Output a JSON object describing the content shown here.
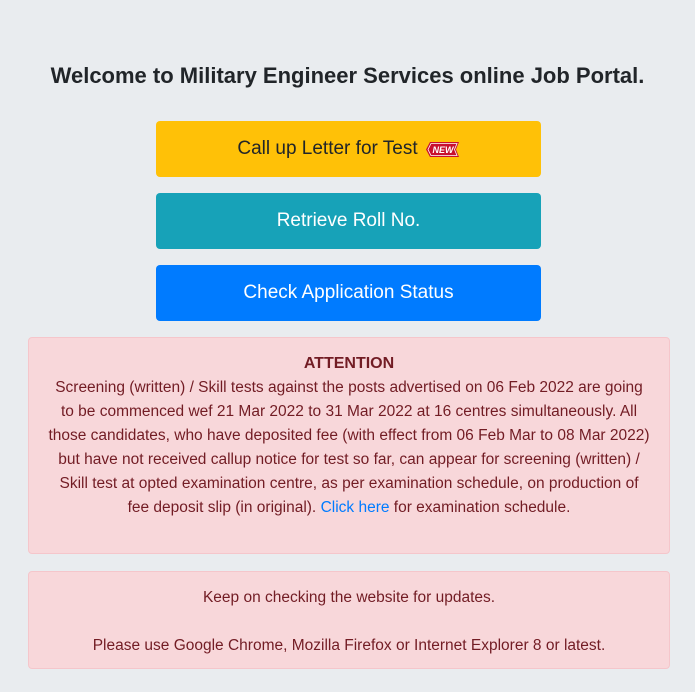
{
  "page": {
    "title": "Welcome to Military Engineer Services online Job Portal."
  },
  "buttons": {
    "call_up_letter": "Call up Letter for Test",
    "new_badge": "NEW",
    "retrieve_roll": "Retrieve Roll No.",
    "check_status": "Check Application Status"
  },
  "colors": {
    "warning": "#ffc107",
    "info": "#17a2b8",
    "primary": "#007bff",
    "alert_bg": "#f8d7da",
    "alert_text": "#721c24",
    "page_bg": "#e9ecef"
  },
  "attention": {
    "heading": "ATTENTION",
    "body_before_link": "Screening (written) / Skill tests against the posts advertised on 06 Feb 2022 are going to be commenced wef 21 Mar 2022 to 31 Mar 2022 at 16 centres simultaneously. All those candidates, who have deposited fee (with effect from 06 Feb Mar to 08 Mar 2022) but have not received callup notice for test so far, can appear for screening (written) / Skill test at opted examination centre, as per examination schedule, on production of fee deposit slip (in original). ",
    "link_text": "Click here",
    "body_after_link": " for examination schedule."
  },
  "notice": {
    "line1": "Keep on checking the website for updates.",
    "line2": "Please use Google Chrome, Mozilla Firefox or Internet Explorer 8 or latest."
  }
}
